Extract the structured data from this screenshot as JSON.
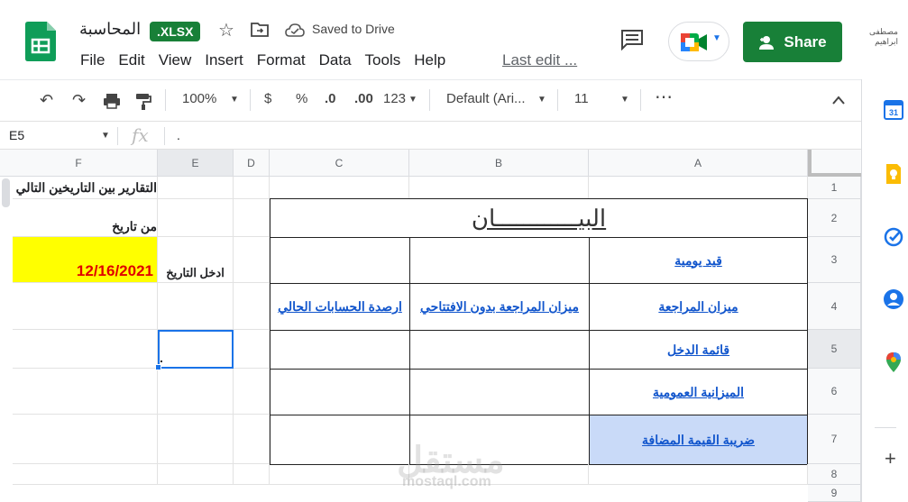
{
  "header": {
    "doc_title": "المحاسبة",
    "format_badge": ".XLSX",
    "saved_status": "Saved to Drive",
    "share_label": "Share",
    "account_name": "مصطفى ابراهيم",
    "last_edit": "Last edit ..."
  },
  "menu": [
    "File",
    "Edit",
    "View",
    "Insert",
    "Format",
    "Data",
    "Tools",
    "Help"
  ],
  "toolbar": {
    "zoom": "100%",
    "currency": "$",
    "percent": "%",
    "dec_decrease": ".0",
    "dec_increase": ".00",
    "more_formats": "123",
    "font": "Default (Ari...",
    "font_size": "11"
  },
  "formula_bar": {
    "cell_ref": "E5",
    "value": "."
  },
  "columns": [
    "F",
    "E",
    "D",
    "C",
    "B",
    "A"
  ],
  "rows": [
    "1",
    "2",
    "3",
    "4",
    "5",
    "6",
    "7",
    "8",
    "9"
  ],
  "cells": {
    "F1": "التقارير بين التاريخين التالي",
    "F2": "من تاريخ",
    "F3": "12/16/2021",
    "E3": "ادخل التاريخ",
    "E5": ".",
    "AB2": "البيــــــــــــان",
    "A3": "قيد يومية",
    "A4": "ميزان المراجعة",
    "A5": "قائمة الدخل",
    "A6": "الميزانية العمومية",
    "A7": "ضريبة القيمة المضافة",
    "B4": "ميزان المراجعة بدون الافتتاحي",
    "C4": "ارصدة الحسابات الحالي"
  },
  "watermark": {
    "arabic": "مستقل",
    "latin": "mostaql.com"
  },
  "colors": {
    "brand_green": "#188038",
    "highlight_yellow": "#ffff00",
    "date_red": "#e00000",
    "cell_blue": "#c9daf8",
    "link_blue": "#1155cc",
    "selection": "#1a73e8"
  }
}
